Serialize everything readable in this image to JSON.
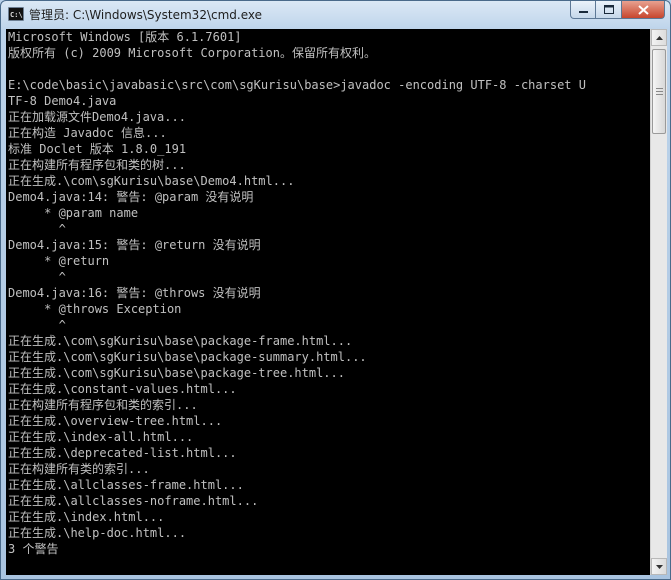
{
  "window": {
    "title": "管理员: C:\\Windows\\System32\\cmd.exe",
    "icon_label": "C:\\",
    "controls": {
      "minimize": "minimize-icon",
      "maximize": "maximize-icon",
      "close": "close-icon"
    }
  },
  "console": {
    "lines": [
      "Microsoft Windows [版本 6.1.7601]",
      "版权所有 (c) 2009 Microsoft Corporation。保留所有权利。",
      "",
      "E:\\code\\basic\\javabasic\\src\\com\\sgKurisu\\base>javadoc -encoding UTF-8 -charset U",
      "TF-8 Demo4.java",
      "正在加载源文件Demo4.java...",
      "正在构造 Javadoc 信息...",
      "标准 Doclet 版本 1.8.0_191",
      "正在构建所有程序包和类的树...",
      "正在生成.\\com\\sgKurisu\\base\\Demo4.html...",
      "Demo4.java:14: 警告: @param 没有说明",
      "     * @param name",
      "       ^",
      "Demo4.java:15: 警告: @return 没有说明",
      "     * @return",
      "       ^",
      "Demo4.java:16: 警告: @throws 没有说明",
      "     * @throws Exception",
      "       ^",
      "正在生成.\\com\\sgKurisu\\base\\package-frame.html...",
      "正在生成.\\com\\sgKurisu\\base\\package-summary.html...",
      "正在生成.\\com\\sgKurisu\\base\\package-tree.html...",
      "正在生成.\\constant-values.html...",
      "正在构建所有程序包和类的索引...",
      "正在生成.\\overview-tree.html...",
      "正在生成.\\index-all.html...",
      "正在生成.\\deprecated-list.html...",
      "正在构建所有类的索引...",
      "正在生成.\\allclasses-frame.html...",
      "正在生成.\\allclasses-noframe.html...",
      "正在生成.\\index.html...",
      "正在生成.\\help-doc.html...",
      "3 个警告"
    ],
    "colors": {
      "background": "#000000",
      "text": "#c0c0c0"
    }
  },
  "scrollbar": {
    "up": "scroll-up-arrow-icon",
    "down": "scroll-down-arrow-icon"
  }
}
